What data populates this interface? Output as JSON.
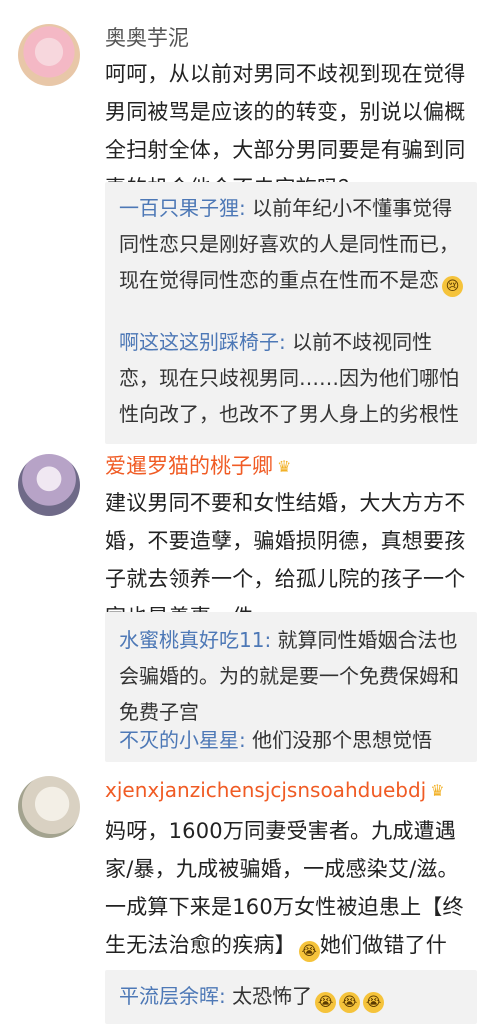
{
  "comments": [
    {
      "username": "奥奥芋泥",
      "content": "呵呵，从以前对男同不歧视到现在觉得男同被骂是应该的的转变，别说以偏概全扫射全体，大部分男同要是有骗到同妻的机会他会不去实施吗？",
      "replies": [
        {
          "name": "一百只果子狸:",
          "text": " 以前年纪小不懂事觉得同性恋只是刚好喜欢的人是同性而已，现在觉得同性恋的重点在性而不是恋",
          "emoji": "😢"
        },
        {
          "name": "啊这这这别踩椅子:",
          "text": " 以前不歧视同性恋，现在只歧视男同……因为他们哪怕性向改了，也改不了男人身上的劣根性"
        }
      ]
    },
    {
      "username": "爱暹罗猫的桃子卿",
      "vip_icon": "crown-icon",
      "content": "建议男同不要和女性结婚，大大方方不婚，不要造孽，骗婚损阴德，真想要孩子就去领养一个，给孤儿院的孩子一个家也是善事一件。",
      "replies": [
        {
          "name": "水蜜桃真好吃11:",
          "text": " 就算同性婚姻合法也会骗婚的。为的就是要一个免费保姆和免费子宫"
        },
        {
          "name": "不灭的小星星:",
          "text": " 他们没那个思想觉悟"
        }
      ]
    },
    {
      "username": "xjenxjanzichensjcjsnsoahduebdj",
      "vip_icon": "crown-icon",
      "content_part1": "妈呀，1600万同妻受害者。九成遭遇家/暴，九成被骗婚，一成感染艾/滋。一成算下来是160万女性被迫患上【终生无法治愈的疾病】",
      "content_emoji": "😭",
      "content_part2": "她们做错了什么，要被这样当成工/具！",
      "replies": [
        {
          "name": "平流层余晖:",
          "text": " 太恐怖了",
          "emojis": [
            "😭",
            "😭",
            "😭"
          ]
        }
      ]
    }
  ]
}
